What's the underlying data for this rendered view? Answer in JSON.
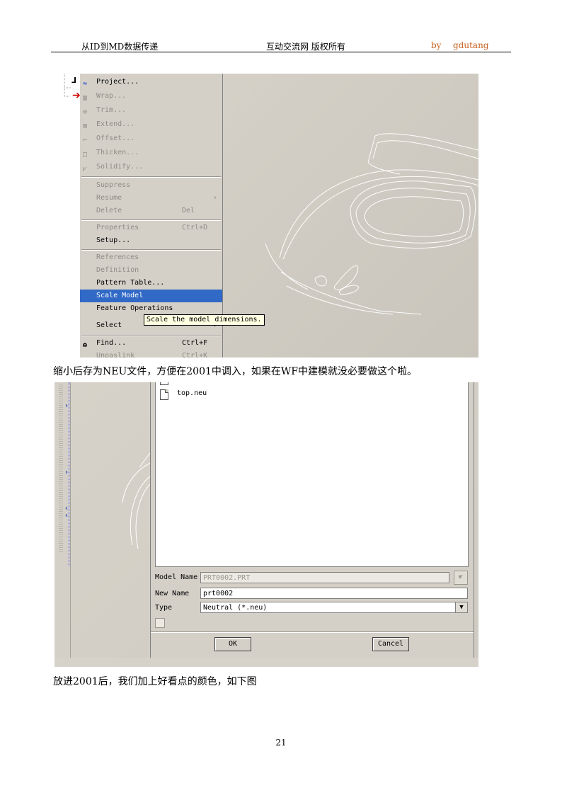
{
  "header": {
    "left": "从ID到MD数据传递",
    "center": "互动交流网 版权所有",
    "by": "by",
    "author": "gdutang"
  },
  "screenshot1": {
    "menu_items": [
      {
        "label": "Project...",
        "shortcut": "",
        "disabled": false
      },
      {
        "label": "Wrap...",
        "shortcut": "",
        "disabled": true
      },
      {
        "label": "Trim...",
        "shortcut": "",
        "disabled": true
      },
      {
        "label": "Extend...",
        "shortcut": "",
        "disabled": true
      },
      {
        "label": "Offset...",
        "shortcut": "",
        "disabled": true
      },
      {
        "label": "Thicken...",
        "shortcut": "",
        "disabled": true
      },
      {
        "label": "Solidify...",
        "shortcut": "",
        "disabled": true
      },
      {
        "label": "Suppress",
        "shortcut": "",
        "disabled": true
      },
      {
        "label": "Resume",
        "shortcut": "›",
        "disabled": true
      },
      {
        "label": "Delete",
        "shortcut": "Del",
        "disabled": true
      },
      {
        "label": "Properties",
        "shortcut": "Ctrl+D",
        "disabled": true
      },
      {
        "label": "Setup...",
        "shortcut": "",
        "disabled": false
      },
      {
        "label": "References",
        "shortcut": "",
        "disabled": true
      },
      {
        "label": "Definition",
        "shortcut": "",
        "disabled": true
      },
      {
        "label": "Pattern Table...",
        "shortcut": "",
        "disabled": false
      },
      {
        "label": "Scale Model",
        "shortcut": "",
        "disabled": false,
        "selected": true
      },
      {
        "label": "Feature Operations",
        "shortcut": "",
        "disabled": false
      },
      {
        "label": "Select",
        "shortcut": "›",
        "disabled": false
      },
      {
        "label": "Find...",
        "shortcut": "Ctrl+F",
        "disabled": false
      },
      {
        "label": "Unpaslink",
        "shortcut": "Ctrl+K",
        "disabled": true
      }
    ],
    "tooltip": "Scale the model dimensions."
  },
  "paragraph1": "缩小后存为NEU文件，方便在2001中调入，如果在WF中建模就没必要做这个啦。",
  "screenshot2": {
    "file_name": "top.neu",
    "model_name_label": "Model Name",
    "model_name_value": "PRT0002.PRT",
    "new_name_label": "New Name",
    "new_name_value": "prt0002",
    "type_label": "Type",
    "type_value": "Neutral (*.neu)",
    "ok_label": "OK",
    "cancel_label": "Cancel"
  },
  "paragraph2": "放进2001后，我们加上好看点的颜色，如下图",
  "page_number": "21",
  "colors": {
    "highlight": "#3169c6",
    "menu_bg": "#d4d0c8",
    "viewport_bg": "#d2cec5",
    "accent_orange": "#c8611e"
  },
  "icons": {
    "red_arrow": "insert-arrow-icon",
    "project": "project-icon",
    "find": "binoculars-icon",
    "file": "document-icon"
  }
}
